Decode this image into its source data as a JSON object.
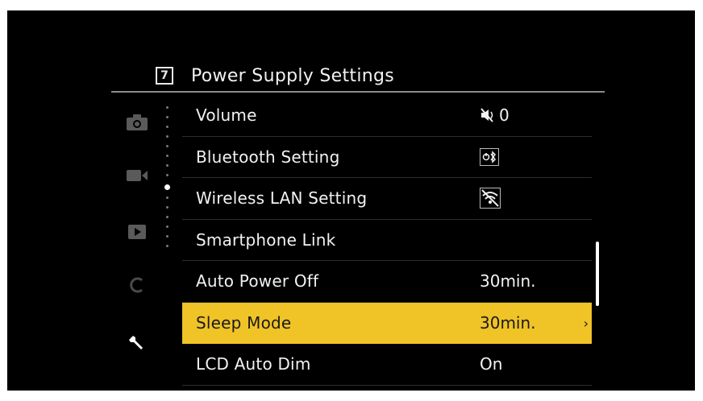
{
  "header": {
    "page_number": "7",
    "title": "Power Supply Settings"
  },
  "tabs": [
    {
      "icon": "camera-icon"
    },
    {
      "icon": "video-icon"
    },
    {
      "icon": "playback-icon"
    },
    {
      "icon": "custom-icon"
    },
    {
      "icon": "wrench-icon"
    }
  ],
  "menu": {
    "items": [
      {
        "label": "Volume",
        "value": "0",
        "value_icon": "speaker-muted-icon"
      },
      {
        "label": "Bluetooth Setting",
        "value": "",
        "value_icon": "bluetooth-icon"
      },
      {
        "label": "Wireless LAN Setting",
        "value": "",
        "value_icon": "wifi-off-icon"
      },
      {
        "label": "Smartphone Link",
        "value": ""
      },
      {
        "label": "Auto Power Off",
        "value": "30min."
      },
      {
        "label": "Sleep Mode",
        "value": "30min.",
        "selected": true
      },
      {
        "label": "LCD Auto Dim",
        "value": "On"
      }
    ],
    "selected_chevron": "›"
  },
  "colors": {
    "highlight": "#f0c327",
    "background": "#000000",
    "text": "#f2f2f2"
  }
}
